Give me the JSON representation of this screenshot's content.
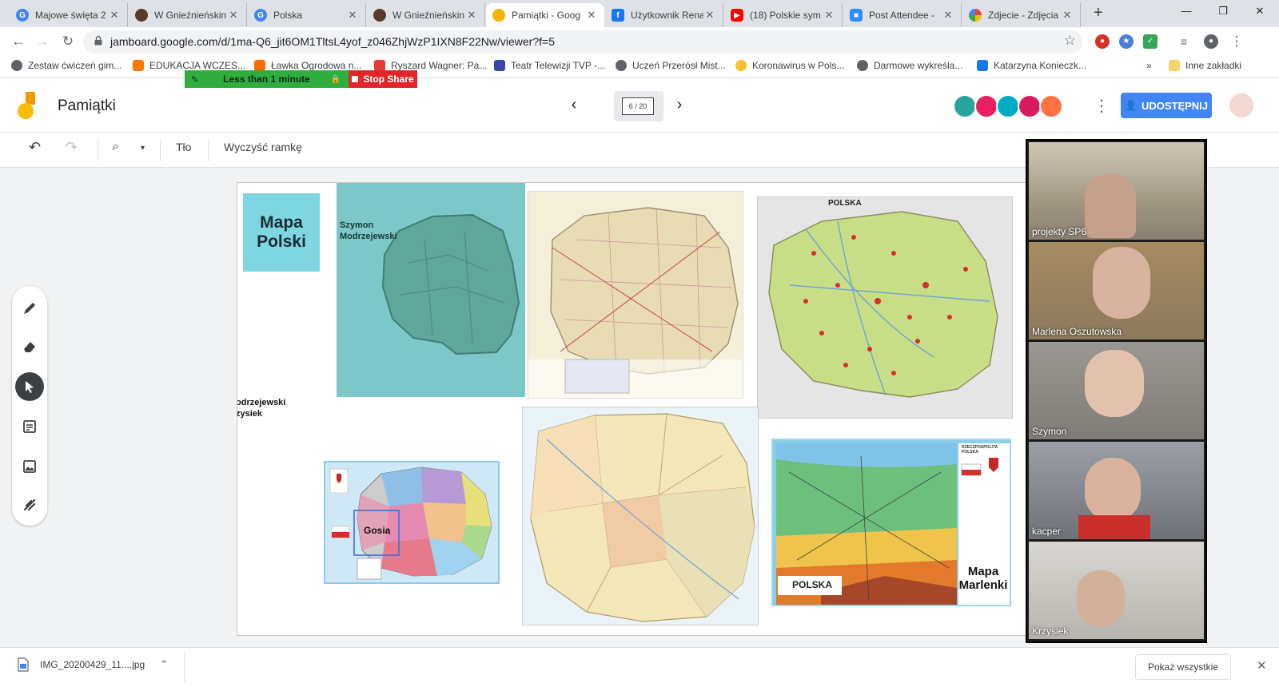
{
  "browser": {
    "tabs": [
      {
        "title": "Majowe święta 2",
        "icon": "google-icon",
        "color": "#4285f4"
      },
      {
        "title": "W Gnieźnieńskin",
        "icon": "site-icon",
        "color": "#5a3a2a"
      },
      {
        "title": "Polska",
        "icon": "google-icon",
        "color": "#4285f4"
      },
      {
        "title": "W Gnieźnieńskin",
        "icon": "site-icon",
        "color": "#5a3a2a"
      },
      {
        "title": "Pamiątki - Goog",
        "icon": "jamboard-icon",
        "color": "#f4b400"
      },
      {
        "title": "Użytkownik Rena",
        "icon": "facebook-icon",
        "color": "#1877f2"
      },
      {
        "title": "(18) Polskie sym",
        "icon": "youtube-icon",
        "color": "#ff0000"
      },
      {
        "title": "Post Attendee -",
        "icon": "zoom-icon",
        "color": "#2d8cff"
      },
      {
        "title": "Zdjecie - Zdjęcia",
        "icon": "photos-icon",
        "color": "#34a853"
      }
    ],
    "active_tab": 4,
    "url": "jamboard.google.com/d/1ma-Q6_jit6OM1TltsL4yof_z046ZhjWzP1IXN8F22Nw/viewer?f=5",
    "bookmarks": [
      {
        "label": "Zestaw ćwiczeń gim...",
        "color": "#5f6368"
      },
      {
        "label": "EDUKACJA WCZES...",
        "color": "#f57c00"
      },
      {
        "label": "Ławka Ogrodowa n...",
        "color": "#ff6d00"
      },
      {
        "label": "Ryszard Wagner: Pa...",
        "color": "#e53935"
      },
      {
        "label": "Teatr Telewizji TVP -...",
        "color": "#3949ab"
      },
      {
        "label": "Uczeń Przerósł Mist...",
        "color": "#5f6368"
      },
      {
        "label": "Koronawirus w Pols...",
        "color": "#fbc02d"
      },
      {
        "label": "Darmowe wykreśla...",
        "color": "#5f6368"
      },
      {
        "label": "Katarzyna Konieczk...",
        "color": "#1877f2"
      }
    ],
    "bookmarks_overflow": "»",
    "other_bookmarks": "Inne zakładki"
  },
  "zoom_share": {
    "timer": "Less than 1 minute",
    "stop": "Stop Share"
  },
  "jamboard": {
    "title": "Pamiątki",
    "frame_counter": "6 / 20",
    "share_button": "UDOSTĘPNIJ",
    "toolbar": {
      "background": "Tło",
      "clear_frame": "Wyczyść ramkę"
    },
    "canvas": {
      "sticky_note": "Mapa Polski",
      "labels": {
        "szymon": "Szymon Modrzejewski",
        "partial_name": "odrzejewski",
        "partial_name2": "zysiek",
        "gosia": "Gosia",
        "marlena": "Mapa Marlenki"
      },
      "map_titles": {
        "polska": "POLSKA",
        "polska_fizyczna": "POLSKA",
        "rzeczpospolita": "RZECZPOSPOLITA POLSKA"
      }
    }
  },
  "participants": [
    {
      "name": "projekty SP6"
    },
    {
      "name": "Marlena Oszutowska"
    },
    {
      "name": "Szymon"
    },
    {
      "name": "kacper"
    },
    {
      "name": "Krzysiek"
    }
  ],
  "downloads": {
    "file": "IMG_20200429_11....jpg",
    "show_all": "Pokaż wszystkie"
  }
}
